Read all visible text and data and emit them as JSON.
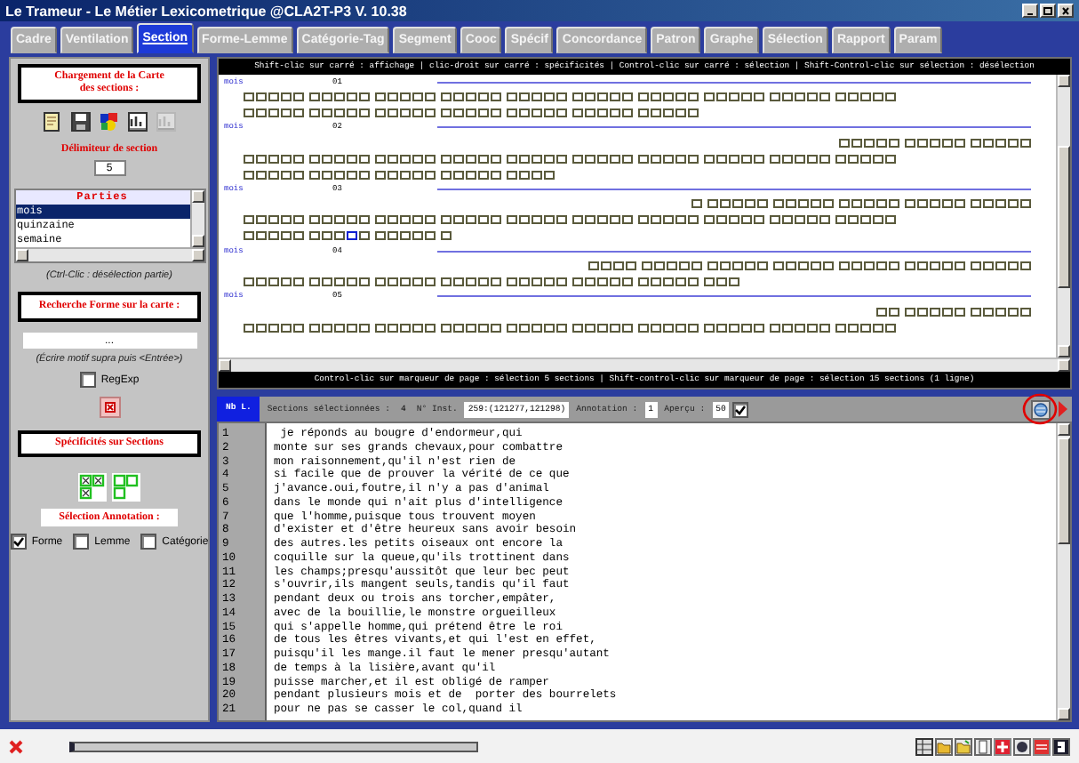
{
  "window": {
    "title": "Le Trameur - Le Métier Lexicometrique @CLA2T-P3 V. 10.38"
  },
  "tabs": [
    {
      "label": "Cadre",
      "selected": false
    },
    {
      "label": "Ventilation",
      "selected": false
    },
    {
      "label": "Section",
      "selected": true
    },
    {
      "label": "Forme-Lemme",
      "selected": false
    },
    {
      "label": "Catégorie-Tag",
      "selected": false
    },
    {
      "label": "Segment",
      "selected": false
    },
    {
      "label": "Cooc",
      "selected": false
    },
    {
      "label": "Spécif",
      "selected": false
    },
    {
      "label": "Concordance",
      "selected": false
    },
    {
      "label": "Patron",
      "selected": false
    },
    {
      "label": "Graphe",
      "selected": false
    },
    {
      "label": "Sélection",
      "selected": false
    },
    {
      "label": "Rapport",
      "selected": false
    },
    {
      "label": "Param",
      "selected": false
    }
  ],
  "left_panel": {
    "map_loading": {
      "title": "Chargement de la Carte des sections :",
      "tools": [
        {
          "kind": "note",
          "disabled": false
        },
        {
          "kind": "save",
          "disabled": false
        },
        {
          "kind": "palette",
          "disabled": false
        },
        {
          "kind": "chart",
          "disabled": false
        },
        {
          "kind": "chart",
          "disabled": true
        }
      ]
    },
    "delimiter": {
      "label": "Délimiteur de section",
      "value": "5"
    },
    "parts": {
      "header": "Parties",
      "items": [
        {
          "label": "mois",
          "selected": true
        },
        {
          "label": "quinzaine",
          "selected": false
        },
        {
          "label": "semaine",
          "selected": false
        }
      ],
      "hint": "(Ctrl-Clic : désélection partie)"
    },
    "search": {
      "title": "Recherche Forme sur la carte :",
      "value": "...",
      "hint": "(Écrire motif supra puis <Entrée>)",
      "regexp": {
        "label": "RegExp",
        "checked": false
      }
    },
    "specificities": {
      "title": "Spécificités sur Sections"
    },
    "annotation": {
      "title": "Sélection Annotation :",
      "options": [
        {
          "label": "Forme",
          "checked": true
        },
        {
          "label": "Lemme",
          "checked": false
        },
        {
          "label": "Catégorie",
          "checked": false
        }
      ]
    }
  },
  "section_map": {
    "header": "Shift-clic sur carré : affichage | clic-droit sur carré : spécificités | Control-clic sur carré : sélection | Shift-Control-clic sur sélection : désélection",
    "sections": [
      {
        "label": "mois",
        "number": "01"
      },
      {
        "label": "mois",
        "number": "02"
      },
      {
        "label": "mois",
        "number": "03"
      },
      {
        "label": "mois",
        "number": "04"
      },
      {
        "label": "mois",
        "number": "05"
      }
    ],
    "footer": "Control-clic sur marqueur de page : sélection 5 sections | Shift-control-clic sur marqueur de page : sélection 15 sections (1 ligne)"
  },
  "info_bar": {
    "line_count_label": "Nb L.",
    "selected_sections": {
      "label": "Sections sélectionnées :",
      "value": "4"
    },
    "instance": {
      "label": "N° Inst.",
      "value": "259:(121277,121298)"
    },
    "annotation": {
      "label": "Annotation :",
      "value": "1"
    },
    "preview": {
      "label": "Aperçu :",
      "value": "50",
      "checked": true
    }
  },
  "text_view": {
    "lines": [
      {
        "number": "1",
        "text": " je réponds au bougre d'endormeur,qui"
      },
      {
        "number": "2",
        "text": "monte sur ses grands chevaux,pour combattre"
      },
      {
        "number": "3",
        "text": "mon raisonnement,qu'il n'est rien de"
      },
      {
        "number": "4",
        "text": "si facile que de prouver la vérité de ce que"
      },
      {
        "number": "5",
        "text": "j'avance.oui,foutre,il n'y a pas d'animal"
      },
      {
        "number": "6",
        "text": "dans le monde qui n'ait plus d'intelligence"
      },
      {
        "number": "7",
        "text": "que l'homme,puisque tous trouvent moyen"
      },
      {
        "number": "8",
        "text": "d'exister et d'être heureux sans avoir besoin"
      },
      {
        "number": "9",
        "text": "des autres.les petits oiseaux ont encore la"
      },
      {
        "number": "10",
        "text": "coquille sur la queue,qu'ils trottinent dans"
      },
      {
        "number": "11",
        "text": "les champs;presqu'aussitôt que leur bec peut"
      },
      {
        "number": "12",
        "text": "s'ouvrir,ils mangent seuls,tandis qu'il faut"
      },
      {
        "number": "13",
        "text": "pendant deux ou trois ans torcher,empâter,"
      },
      {
        "number": "14",
        "text": "avec de la bouillie,le monstre orgueilleux"
      },
      {
        "number": "15",
        "text": "qui s'appelle homme,qui prétend être le roi"
      },
      {
        "number": "16",
        "text": "de tous les êtres vivants,et qui l'est en effet,"
      },
      {
        "number": "17",
        "text": "puisqu'il les mange.il faut le mener presqu'autant"
      },
      {
        "number": "18",
        "text": "de temps à la lisière,avant qu'il"
      },
      {
        "number": "19",
        "text": "puisse marcher,et il est obligé de ramper"
      },
      {
        "number": "20",
        "text": "pendant plusieurs mois et de  porter des bourrelets"
      },
      {
        "number": "21",
        "text": "pour ne pas se casser le col,quand il"
      }
    ]
  }
}
